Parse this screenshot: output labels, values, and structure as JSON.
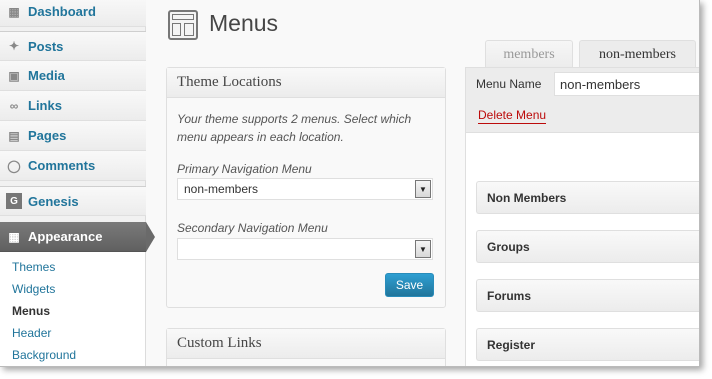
{
  "sidebar": {
    "items": [
      {
        "label": "Dashboard",
        "icon": "dashboard-icon"
      },
      {
        "label": "Posts",
        "icon": "pushpin-icon"
      },
      {
        "label": "Media",
        "icon": "media-icon"
      },
      {
        "label": "Links",
        "icon": "link-icon"
      },
      {
        "label": "Pages",
        "icon": "pages-icon"
      },
      {
        "label": "Comments",
        "icon": "comment-bubble-icon"
      },
      {
        "label": "Genesis",
        "icon": "genesis-g-icon",
        "icon_glyph": "G"
      },
      {
        "label": "Appearance",
        "icon": "appearance-icon"
      }
    ],
    "submenu": [
      "Themes",
      "Widgets",
      "Menus",
      "Header",
      "Background"
    ],
    "active_submenu": "Menus"
  },
  "header": {
    "title": "Menus"
  },
  "theme_locations": {
    "title": "Theme Locations",
    "help": "Your theme supports 2 menus. Select which menu appears in each location.",
    "primary_label": "Primary Navigation Menu",
    "primary_value": "non-members",
    "secondary_label": "Secondary Navigation Menu",
    "secondary_value": "",
    "save_label": "Save"
  },
  "custom_links": {
    "title": "Custom Links"
  },
  "tabs": [
    {
      "label": "members",
      "active": false
    },
    {
      "label": "non-members",
      "active": true
    }
  ],
  "editor": {
    "menu_name_label": "Menu Name",
    "menu_name_value": "non-members",
    "delete_label": "Delete Menu",
    "items": [
      "Non Members",
      "Groups",
      "Forums",
      "Register"
    ]
  },
  "colors": {
    "link": "#21759b",
    "delete": "#bc0b0b",
    "primary_button": "#21759b",
    "current_menu": "#6a6a6a"
  }
}
